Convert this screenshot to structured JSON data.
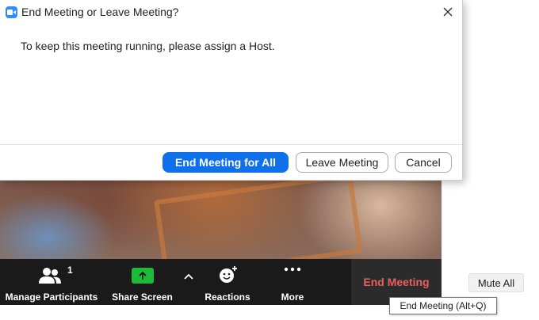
{
  "dialog": {
    "title": "End Meeting or Leave Meeting?",
    "message": "To keep this meeting running, please assign a Host.",
    "buttons": {
      "end_for_all": "End Meeting for All",
      "leave": "Leave Meeting",
      "cancel": "Cancel"
    }
  },
  "toolbar": {
    "participants_label": "Manage Participants",
    "participants_count": "1",
    "share_label": "Share Screen",
    "reactions_label": "Reactions",
    "more_label": "More",
    "end_meeting_label": "End Meeting"
  },
  "side": {
    "mute_all_label": "Mute All"
  },
  "tooltip": {
    "text": "End Meeting (Alt+Q)"
  },
  "colors": {
    "primary_button": "#0e71eb",
    "share_green": "#1fba3a",
    "end_meeting_red": "#e8605c",
    "app_icon_blue": "#2d8cff"
  },
  "icons": {
    "app": "zoom-camera-icon",
    "close": "close-icon",
    "participants": "people-icon",
    "share": "arrow-up-icon",
    "caret": "chevron-up-icon",
    "reactions": "emoji-add-icon",
    "more": "ellipsis-icon"
  }
}
